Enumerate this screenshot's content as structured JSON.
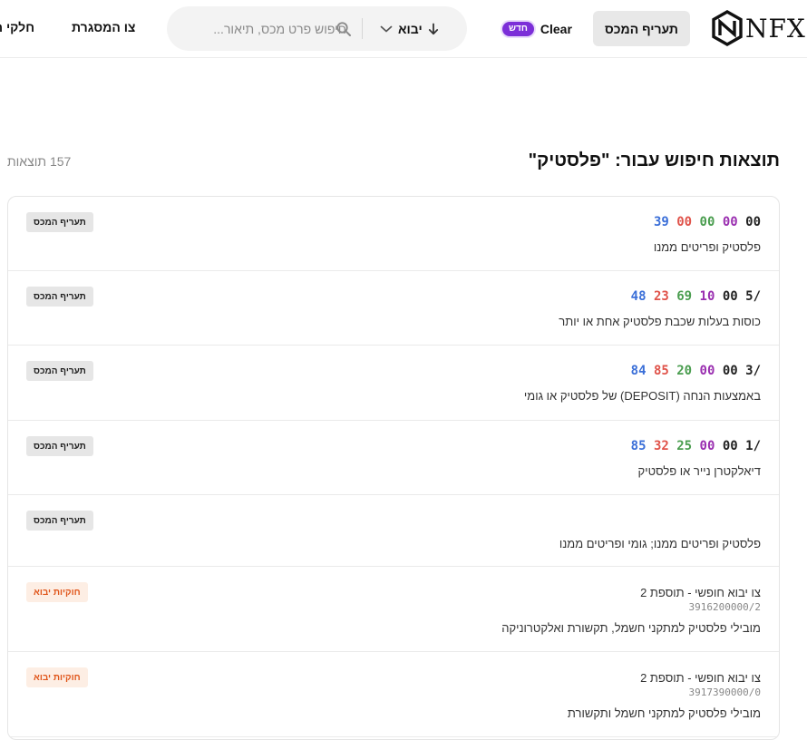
{
  "header": {
    "logo_text": "NFX",
    "tariff_button": "תעריף המכס",
    "clear_label": "Clear",
    "new_badge": "חדש",
    "search_placeholder": "חיפוש פרט מכס, תיאור...",
    "type_select": "יבוא",
    "nav_framework": "צו המסגרת",
    "nav_parts": "חלקי ח"
  },
  "results": {
    "title": "תוצאות חיפוש עבור: \"פלסטיק\"",
    "count": "157 תוצאות"
  },
  "items": [
    {
      "tag": "תעריף המכס",
      "tag_style": "gray",
      "code_parts": [
        "00",
        "00",
        "00",
        "00",
        "39"
      ],
      "description": "פלסטיק ופריטים ממנו"
    },
    {
      "tag": "תעריף המכס",
      "tag_style": "gray",
      "code_parts": [
        "5/",
        "00",
        "10",
        "69",
        "23",
        "48"
      ],
      "description": "כוסות בעלות שכבת פלסטיק אחת או יותר"
    },
    {
      "tag": "תעריף המכס",
      "tag_style": "gray",
      "code_parts": [
        "3/",
        "00",
        "00",
        "20",
        "85",
        "84"
      ],
      "description": "באמצעות הנחה (DEPOSIT) של פלסטיק או גומי"
    },
    {
      "tag": "תעריף המכס",
      "tag_style": "gray",
      "code_parts": [
        "1/",
        "00",
        "00",
        "25",
        "32",
        "85"
      ],
      "description": "דיאלקטרן נייר או פלסטיק"
    },
    {
      "tag": "תעריף המכס",
      "tag_style": "gray",
      "description": "פלסטיק ופריטים ממנו; גומי ופריטים ממנו"
    },
    {
      "tag": "חוקיות יבוא",
      "tag_style": "orange",
      "subtitle": "צו יבוא חופשי - תוספת 2",
      "subcode": "3916200000/2",
      "description": "מובילי פלסטיק למתקני חשמל, תקשורת ואלקטרוניקה"
    },
    {
      "tag": "חוקיות יבוא",
      "tag_style": "orange",
      "subtitle": "צו יבוא חופשי - תוספת 2",
      "subcode": "3917390000/0",
      "description": "מובילי פלסטיק למתקני חשמל ותקשורת"
    }
  ],
  "code_colors": {
    "black": "#222222",
    "blue": "#3b6fd8",
    "red": "#e0534a",
    "green": "#4a9d4f",
    "purple": "#9a2fb0"
  }
}
